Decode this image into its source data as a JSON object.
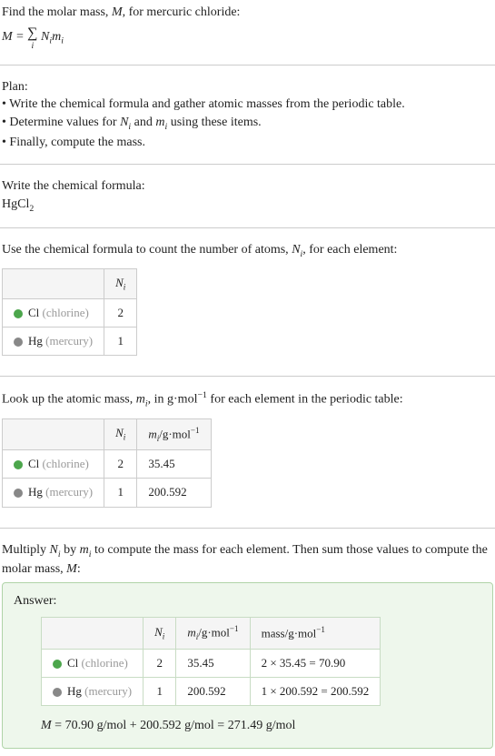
{
  "intro": {
    "line1_prefix": "Find the molar mass, ",
    "line1_var": "M",
    "line1_suffix": ", for mercuric chloride:",
    "formula_lhs": "M",
    "formula_eq": " = ",
    "formula_sigma": "∑",
    "formula_sub": "i",
    "formula_rhs1": " N",
    "formula_rhs1_sub": "i",
    "formula_rhs2": "m",
    "formula_rhs2_sub": "i"
  },
  "plan": {
    "title": "Plan:",
    "b1_a": "• Write the chemical formula and gather atomic masses from the periodic table.",
    "b2_a": "• Determine values for ",
    "b2_ni": "N",
    "b2_ni_sub": "i",
    "b2_b": " and ",
    "b2_mi": "m",
    "b2_mi_sub": "i",
    "b2_c": " using these items.",
    "b3_a": "• Finally, compute the mass."
  },
  "chem": {
    "title": "Write the chemical formula:",
    "formula_a": "HgCl",
    "formula_sub": "2"
  },
  "count": {
    "title_a": "Use the chemical formula to count the number of atoms, ",
    "title_ni": "N",
    "title_ni_sub": "i",
    "title_b": ", for each element:",
    "header_ni": "N",
    "header_ni_sub": "i",
    "row_cl_name": "Cl ",
    "row_cl_label": "(chlorine)",
    "row_cl_n": "2",
    "row_hg_name": "Hg ",
    "row_hg_label": "(mercury)",
    "row_hg_n": "1"
  },
  "mass": {
    "title_a": "Look up the atomic mass, ",
    "title_mi": "m",
    "title_mi_sub": "i",
    "title_b": ", in g·mol",
    "title_exp": "−1",
    "title_c": " for each element in the periodic table:",
    "header_ni": "N",
    "header_ni_sub": "i",
    "header_mi": "m",
    "header_mi_sub": "i",
    "header_mi_unit": "/g·mol",
    "header_mi_exp": "−1",
    "row_cl_name": "Cl ",
    "row_cl_label": "(chlorine)",
    "row_cl_n": "2",
    "row_cl_m": "35.45",
    "row_hg_name": "Hg ",
    "row_hg_label": "(mercury)",
    "row_hg_n": "1",
    "row_hg_m": "200.592"
  },
  "mult": {
    "title_a": "Multiply ",
    "title_ni": "N",
    "title_ni_sub": "i",
    "title_b": " by ",
    "title_mi": "m",
    "title_mi_sub": "i",
    "title_c": " to compute the mass for each element. Then sum those values to compute the molar mass, ",
    "title_M": "M",
    "title_d": ":"
  },
  "answer": {
    "title": "Answer:",
    "header_ni": "N",
    "header_ni_sub": "i",
    "header_mi": "m",
    "header_mi_sub": "i",
    "header_mi_unit": "/g·mol",
    "header_mi_exp": "−1",
    "header_mass": "mass/g·mol",
    "header_mass_exp": "−1",
    "row_cl_name": "Cl ",
    "row_cl_label": "(chlorine)",
    "row_cl_n": "2",
    "row_cl_m": "35.45",
    "row_cl_mass": "2 × 35.45 = 70.90",
    "row_hg_name": "Hg ",
    "row_hg_label": "(mercury)",
    "row_hg_n": "1",
    "row_hg_m": "200.592",
    "row_hg_mass": "1 × 200.592 = 200.592",
    "final_lhs": "M",
    "final_rhs": " = 70.90 g/mol + 200.592 g/mol = 271.49 g/mol"
  }
}
